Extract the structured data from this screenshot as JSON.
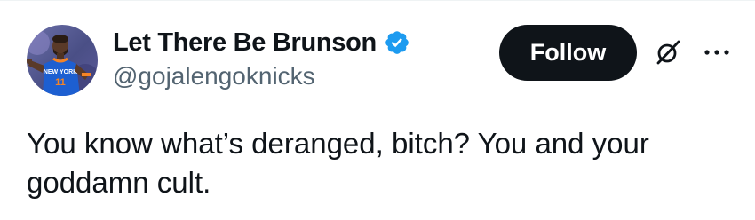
{
  "author": {
    "display_name": "Let There Be Brunson",
    "handle": "@gojalengoknicks",
    "verified": true,
    "avatar_icon": "player-avatar-icon",
    "verified_icon": "verified-badge-icon",
    "verified_color": "#1d9bf0"
  },
  "actions": {
    "follow_label": "Follow",
    "follow_bg": "#0f1419",
    "grok_icon": "grok-icon",
    "more_icon": "more-icon"
  },
  "tweet": {
    "text": "You know what’s deranged, bitch? You and your goddamn cult."
  },
  "colors": {
    "text_primary": "#0f1419",
    "text_secondary": "#536471",
    "background": "#ffffff"
  }
}
